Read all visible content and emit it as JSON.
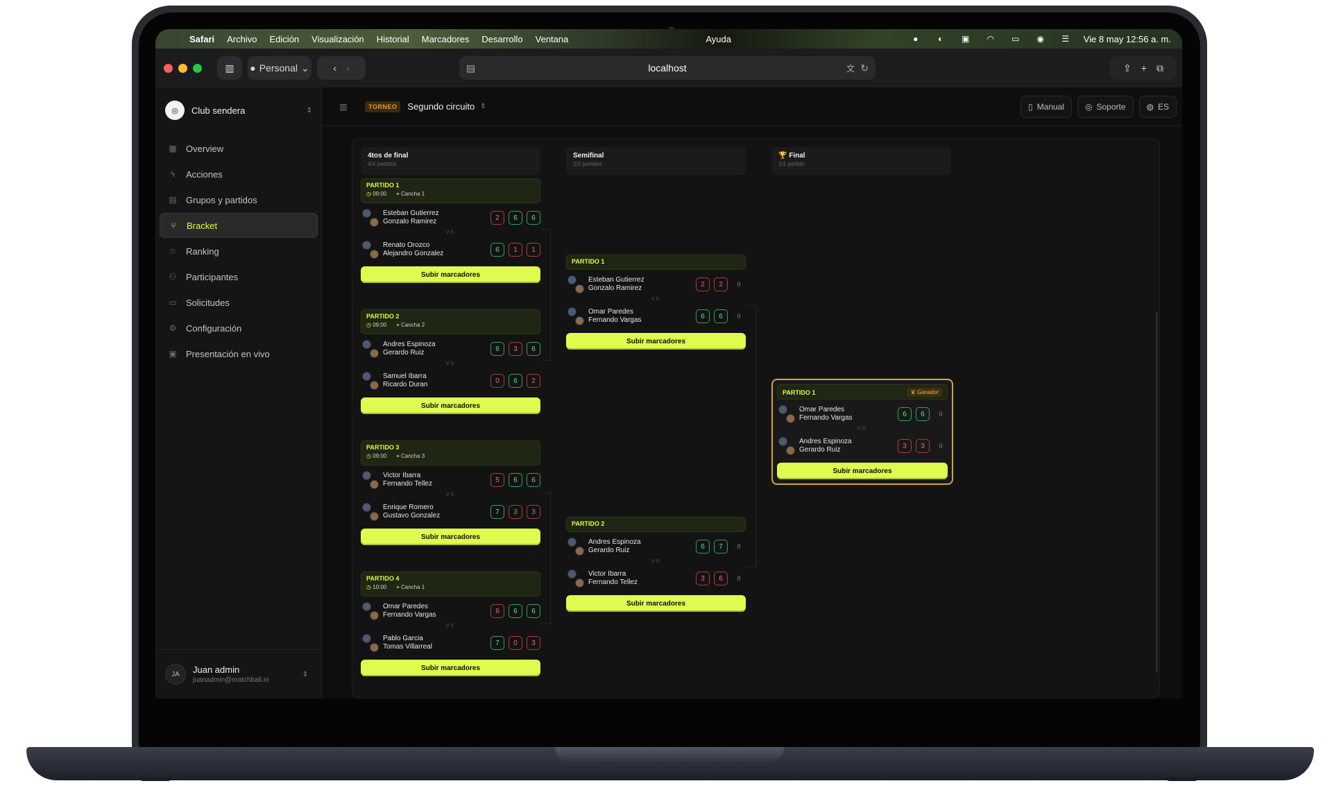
{
  "menubar": {
    "app": "Safari",
    "items": [
      "Archivo",
      "Edición",
      "Visualización",
      "Historial",
      "Marcadores",
      "Desarrollo",
      "Ventana",
      "Ayuda"
    ],
    "clock": "Vie 8 may 12:56 a. m."
  },
  "toolbar": {
    "profile": "Personal",
    "url": "localhost"
  },
  "sidebar": {
    "club": "Club sendera",
    "items": [
      {
        "label": "Overview",
        "icon": "grid-icon"
      },
      {
        "label": "Acciones",
        "icon": "bolt-icon"
      },
      {
        "label": "Grupos y partidos",
        "icon": "table-icon"
      },
      {
        "label": "Bracket",
        "icon": "bracket-icon"
      },
      {
        "label": "Ranking",
        "icon": "star-icon"
      },
      {
        "label": "Participantes",
        "icon": "users-icon"
      },
      {
        "label": "Solicitudes",
        "icon": "inbox-icon"
      },
      {
        "label": "Configuración",
        "icon": "gear-icon"
      },
      {
        "label": "Presentación en vivo",
        "icon": "calendar-icon"
      }
    ],
    "active": "Bracket",
    "user": {
      "initials": "JA",
      "name": "Juan admin",
      "email": "juanadmin@matchball.io"
    }
  },
  "header": {
    "tag": "TORNEO",
    "tournament": "Segundo circuito",
    "buttons": {
      "manual": "Manual",
      "support": "Soporte",
      "lang": "ES"
    }
  },
  "bracket": {
    "vs": "VS",
    "upload_label": "Subir marcadores",
    "winner_badge": "Ganador",
    "rounds": [
      {
        "title": "4tos de final",
        "subtitle": "4/4 partidos"
      },
      {
        "title": "Semifinal",
        "subtitle": "2/2 partidos"
      },
      {
        "title": "Final",
        "subtitle": "1/1 partido"
      }
    ],
    "quarters": [
      {
        "title": "PARTIDO 1",
        "time": "09:00",
        "court": "Cancha 1",
        "team1": {
          "p1": "Esteban Gutierrez",
          "p2": "Gonzalo Ramirez",
          "scores": [
            2,
            6,
            6
          ],
          "result": [
            "l",
            "w",
            "w"
          ]
        },
        "team2": {
          "p1": "Renato Orozco",
          "p2": "Alejandro Gonzalez",
          "scores": [
            6,
            1,
            1
          ],
          "result": [
            "w",
            "l",
            "l"
          ]
        }
      },
      {
        "title": "PARTIDO 2",
        "time": "09:00",
        "court": "Cancha 2",
        "team1": {
          "p1": "Andres Espinoza",
          "p2": "Gerardo Ruiz",
          "scores": [
            6,
            3,
            6
          ],
          "result": [
            "w",
            "l",
            "w"
          ]
        },
        "team2": {
          "p1": "Samuel Ibarra",
          "p2": "Ricardo Duran",
          "scores": [
            0,
            6,
            2
          ],
          "result": [
            "l",
            "w",
            "l"
          ]
        }
      },
      {
        "title": "PARTIDO 3",
        "time": "09:00",
        "court": "Cancha 3",
        "team1": {
          "p1": "Victor Ibarra",
          "p2": "Fernando Tellez",
          "scores": [
            5,
            6,
            6
          ],
          "result": [
            "l",
            "w",
            "w"
          ]
        },
        "team2": {
          "p1": "Enrique Romero",
          "p2": "Gustavo Gonzalez",
          "scores": [
            7,
            3,
            3
          ],
          "result": [
            "w",
            "l",
            "l"
          ]
        }
      },
      {
        "title": "PARTIDO 4",
        "time": "10:00",
        "court": "Cancha 1",
        "team1": {
          "p1": "Omar Paredes",
          "p2": "Fernando Vargas",
          "scores": [
            6,
            6,
            6
          ],
          "result": [
            "l",
            "w",
            "w"
          ]
        },
        "team2": {
          "p1": "Pablo Garcia",
          "p2": "Tomas Villarreal",
          "scores": [
            7,
            0,
            3
          ],
          "result": [
            "w",
            "l",
            "l"
          ]
        }
      }
    ],
    "semis": [
      {
        "title": "PARTIDO 1",
        "team1": {
          "p1": "Esteban Gutierrez",
          "p2": "Gonzalo Ramirez",
          "scores": [
            2,
            2,
            0
          ],
          "result": [
            "l",
            "l",
            "z"
          ]
        },
        "team2": {
          "p1": "Omar Paredes",
          "p2": "Fernando Vargas",
          "scores": [
            6,
            6,
            0
          ],
          "result": [
            "w",
            "w",
            "z"
          ]
        }
      },
      {
        "title": "PARTIDO 2",
        "team1": {
          "p1": "Andres Espinoza",
          "p2": "Gerardo Ruiz",
          "scores": [
            6,
            7,
            0
          ],
          "result": [
            "w",
            "w",
            "z"
          ]
        },
        "team2": {
          "p1": "Victor Ibarra",
          "p2": "Fernando Tellez",
          "scores": [
            3,
            6,
            0
          ],
          "result": [
            "l",
            "l",
            "z"
          ]
        }
      }
    ],
    "final": {
      "title": "PARTIDO 1",
      "team1": {
        "p1": "Omar Paredes",
        "p2": "Fernando Vargas",
        "scores": [
          6,
          6,
          0
        ],
        "result": [
          "w",
          "w",
          "z"
        ]
      },
      "team2": {
        "p1": "Andres Espinoza",
        "p2": "Gerardo Ruiz",
        "scores": [
          3,
          3,
          0
        ],
        "result": [
          "l",
          "l",
          "z"
        ]
      }
    }
  }
}
